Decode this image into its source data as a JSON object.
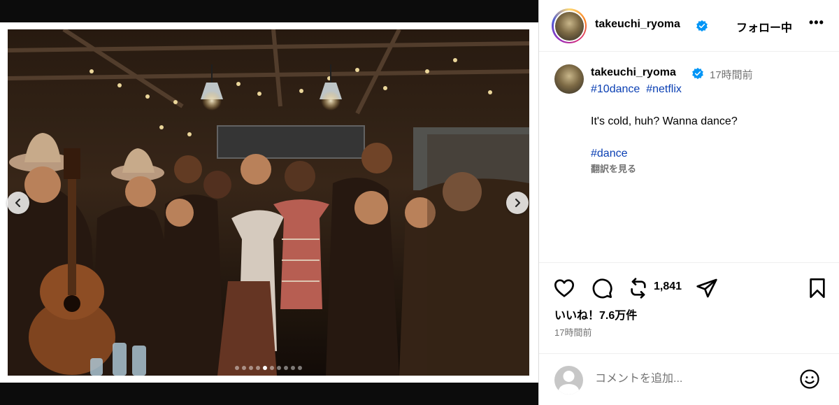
{
  "header": {
    "username": "takeuchi_ryoma",
    "follow_state": "フォロー中",
    "more_label": "•••"
  },
  "caption": {
    "username": "takeuchi_ryoma",
    "time_ago": "17時間前",
    "hashtags": [
      "#10dance",
      "#netflix"
    ],
    "text": "It's cold, huh? Wanna dance?",
    "hashtag_bottom": "#dance",
    "translate_label": "翻訳を見る"
  },
  "actions": {
    "repost_count": "1,841"
  },
  "likes_label": "いいね！7.6万件",
  "post_time": "17時間前",
  "comment": {
    "placeholder": "コメントを追加..."
  },
  "carousel": {
    "total": 10,
    "active_index": 4
  },
  "colors": {
    "hashtag": "#0a3fb3",
    "verified": "#0095f6",
    "muted": "#737373",
    "media_bg": "#0c0c0c"
  },
  "icons": {
    "like": "heart-icon",
    "comment": "comment-bubble-icon",
    "repost": "repost-icon",
    "share": "paper-plane-icon",
    "save": "bookmark-icon",
    "emoji": "smiley-icon",
    "prev": "chevron-left-icon",
    "next": "chevron-right-icon",
    "verified": "verified-badge-icon"
  }
}
